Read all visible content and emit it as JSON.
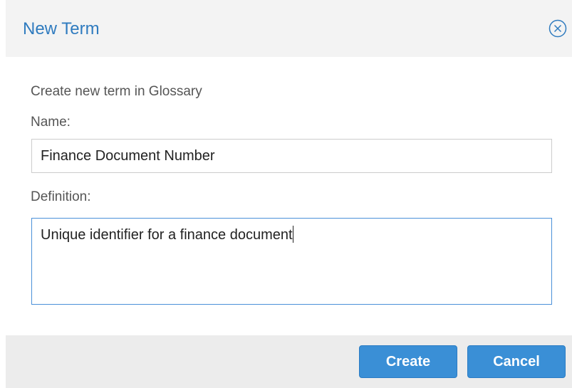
{
  "dialog": {
    "title": "New Term",
    "close_icon": "close-circle-icon"
  },
  "form": {
    "intro": "Create new term in Glossary",
    "name_label": "Name:",
    "name_value": "Finance Document Number",
    "definition_label": "Definition:",
    "definition_value": "Unique identifier for a finance document"
  },
  "footer": {
    "create_label": "Create",
    "cancel_label": "Cancel"
  },
  "colors": {
    "title": "#2f7bbf",
    "button": "#3a8fd6",
    "focus_border": "#4a90d9"
  }
}
